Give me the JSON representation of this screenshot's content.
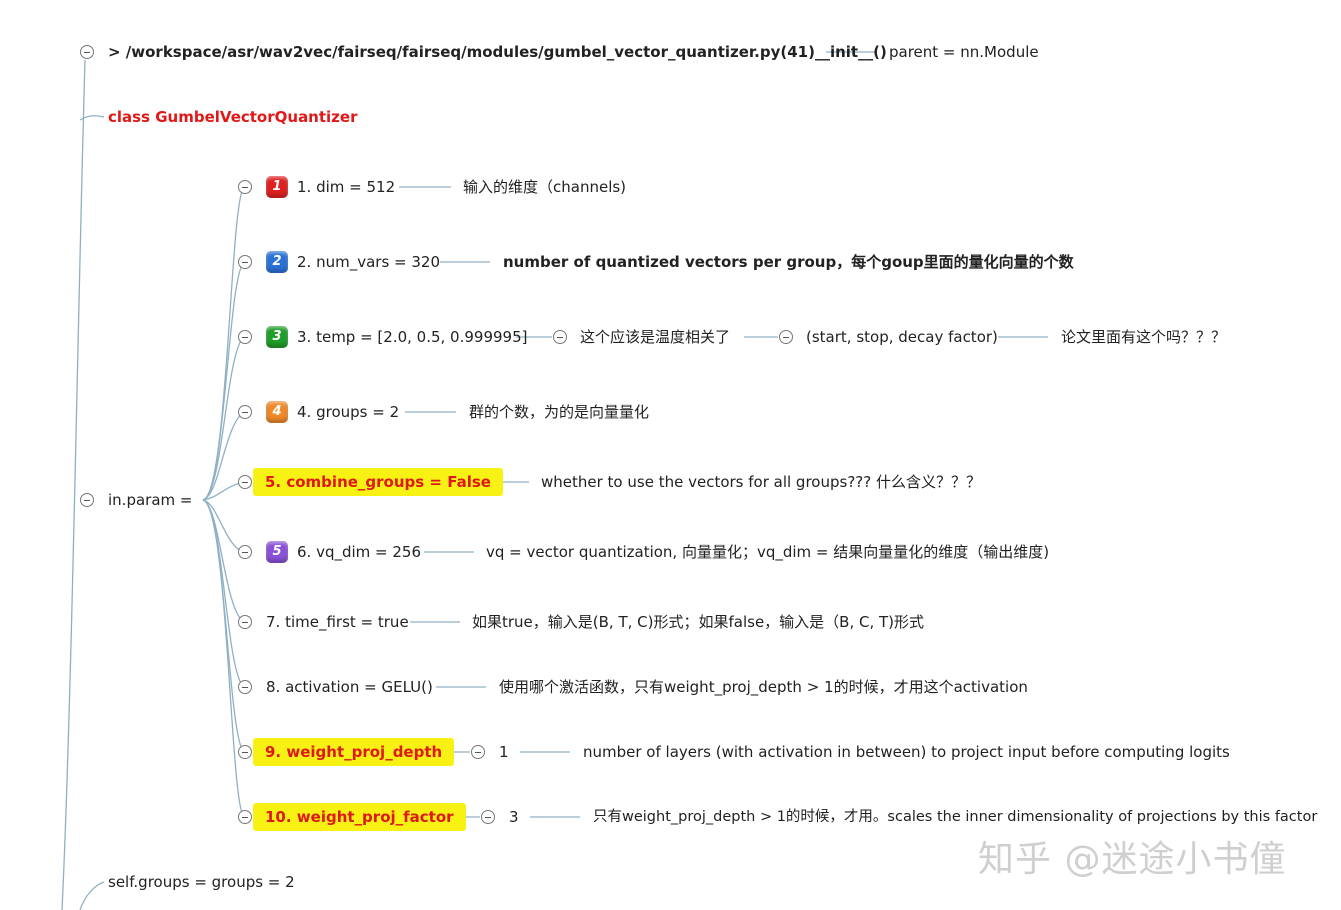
{
  "root": {
    "title": "> /workspace/asr/wav2vec/fairseq/fairseq/modules/gumbel_vector_quantizer.py(41)__init__()",
    "note": "parent = nn.Module"
  },
  "class_label": "class GumbelVectorQuantizer",
  "in_param": {
    "label": "in.param =",
    "params": [
      {
        "badge": "1",
        "badge_color": "#e02020",
        "text": "1. dim = 512",
        "notes": [
          "输入的维度（channels)"
        ]
      },
      {
        "badge": "2",
        "badge_color": "#2a72d8",
        "text": "2. num_vars = 320",
        "notes": [
          "number of quantized vectors per group，每个goup里面的量化向量的个数"
        ]
      },
      {
        "badge": "3",
        "badge_color": "#1f9e2a",
        "text": "3. temp = [2.0, 0.5, 0.999995]",
        "notes": [
          "这个应该是温度相关了",
          "(start, stop, decay factor)",
          "论文里面有这个吗？？？"
        ]
      },
      {
        "badge": "4",
        "badge_color": "#f08a2a",
        "text": "4. groups = 2",
        "notes": [
          "群的个数，为的是向量量化"
        ]
      },
      {
        "text": "5. combine_groups = False",
        "notes": [
          "whether to use the vectors for all groups??? 什么含义？？？"
        ]
      },
      {
        "badge": "5",
        "badge_color": "#8a52d8",
        "text": "6. vq_dim = 256",
        "notes": [
          "vq = vector quantization, 向量量化；vq_dim = 结果向量量化的维度（输出维度)"
        ]
      },
      {
        "text": "7. time_first = true",
        "notes": [
          "如果true，输入是(B, T, C)形式；如果false，输入是（B, C, T)形式"
        ]
      },
      {
        "text": "8. activation = GELU()",
        "notes": [
          "使用哪个激活函数，只有weight_proj_depth > 1的时候，才用这个activation"
        ]
      },
      {
        "text": "9. weight_proj_depth",
        "notes": [
          "1",
          "number of layers (with activation in between) to project input before computing logits"
        ]
      },
      {
        "text": "10. weight_proj_factor",
        "notes": [
          "3",
          "只有weight_proj_depth > 1的时候，才用。scales the inner dimensionality of projections by this factor"
        ]
      }
    ]
  },
  "self_groups": "self.groups = groups = 2",
  "watermark": "知乎 @迷途小书僮",
  "colors": {
    "line": "#8fb0c4",
    "highlight": "#f7f214",
    "red_text": "#e01818"
  }
}
